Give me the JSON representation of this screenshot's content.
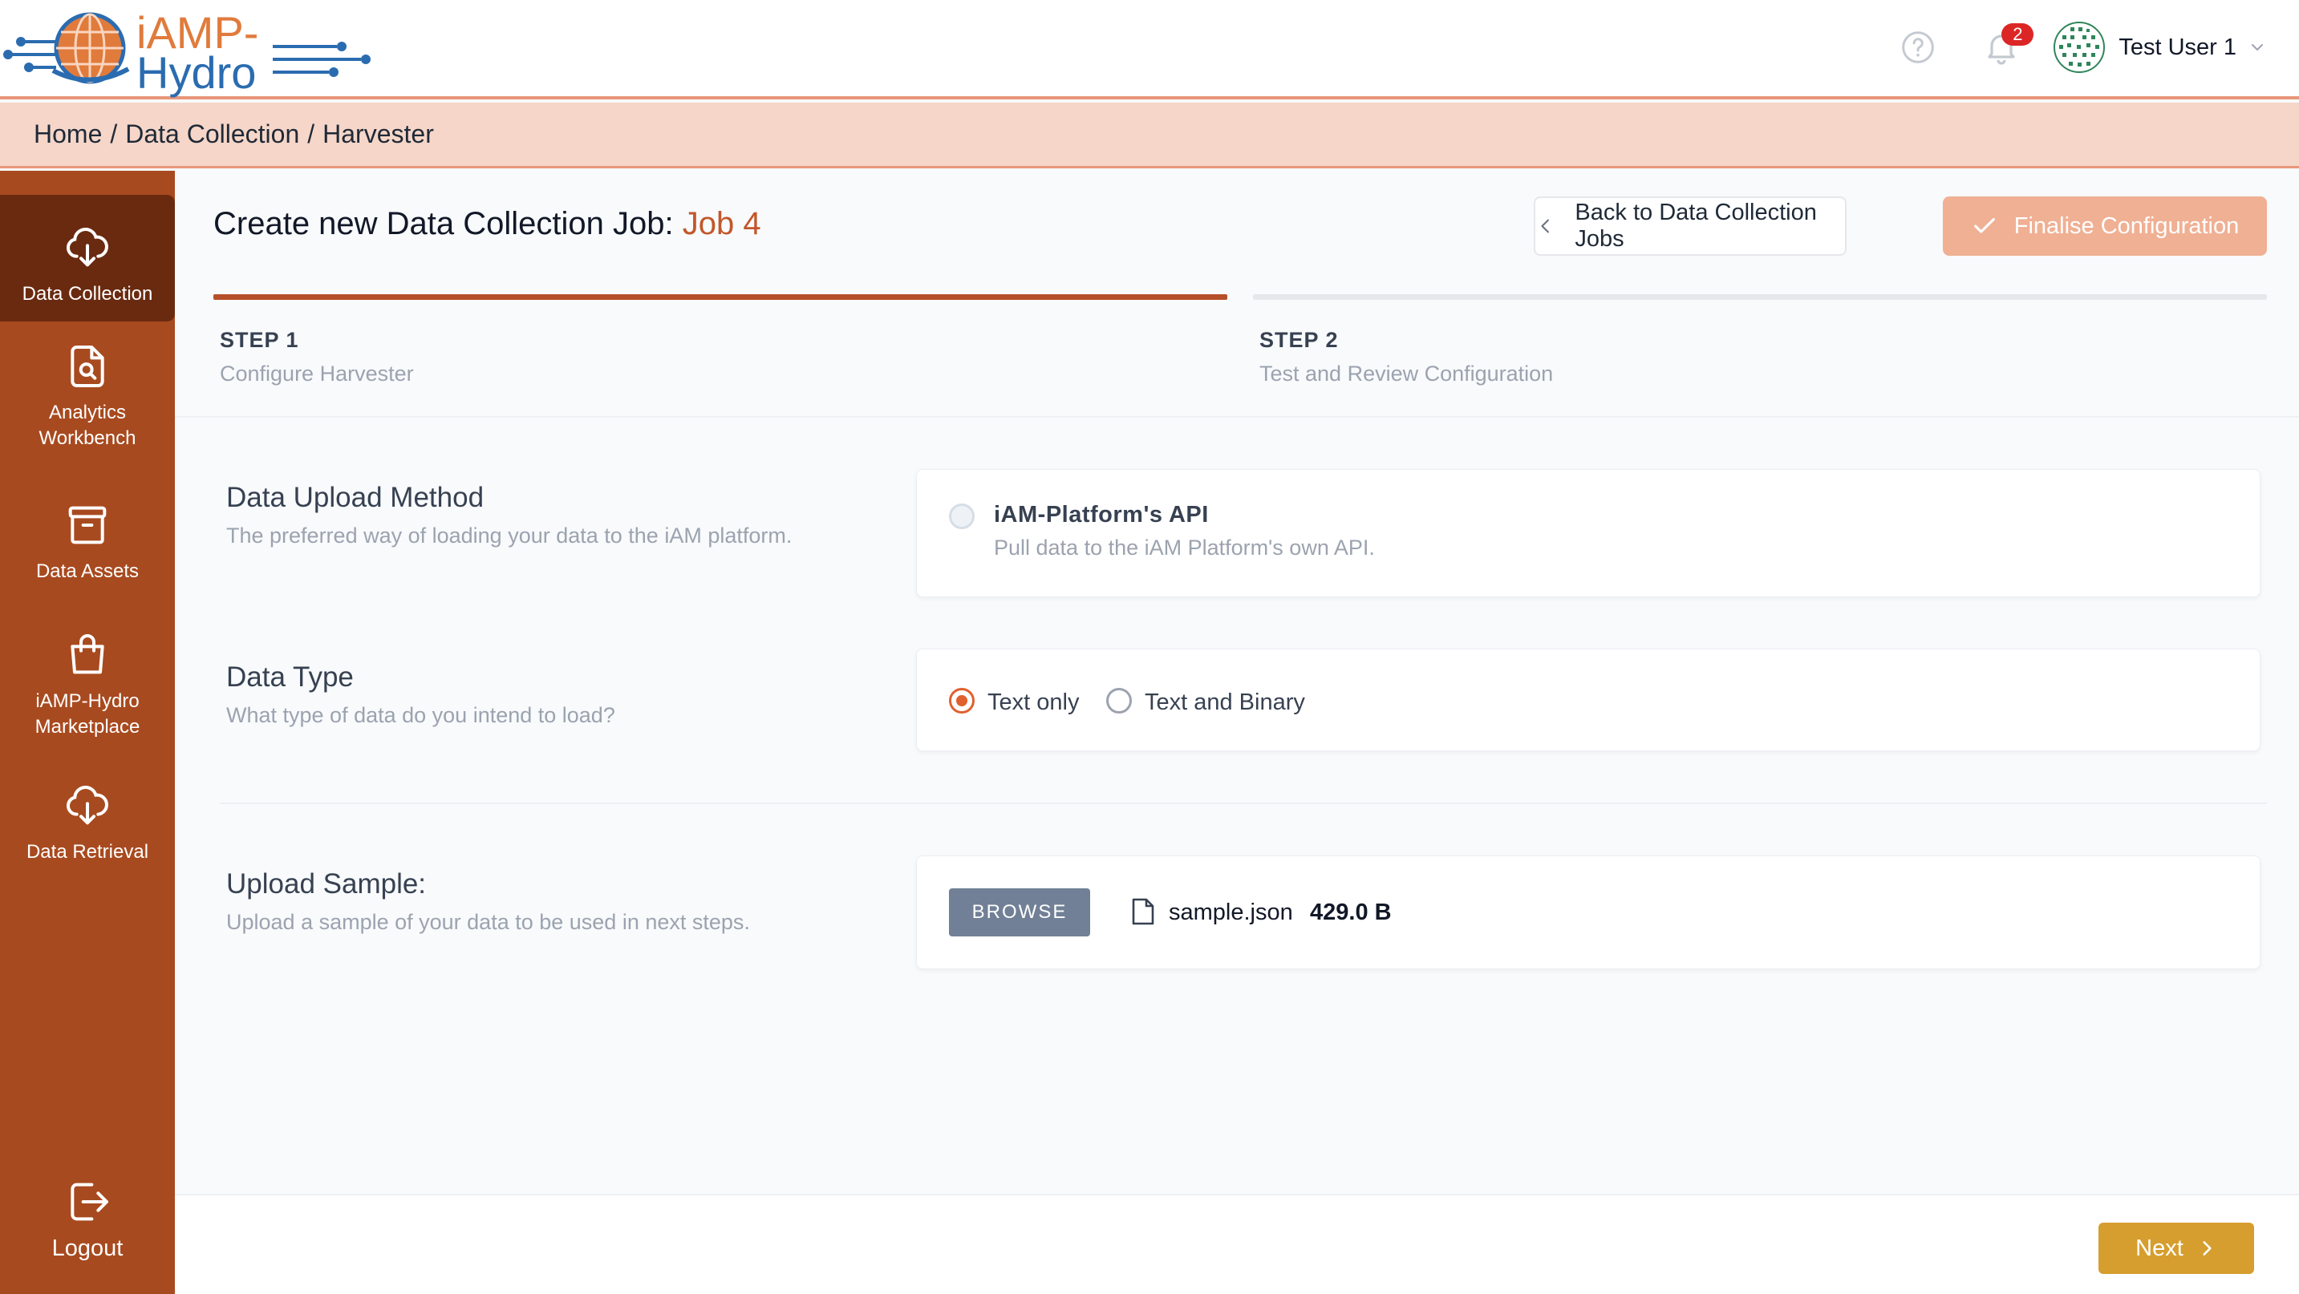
{
  "header": {
    "logo": {
      "line1": "iAMP-",
      "line2": "Hydro"
    },
    "notifications_count": "2",
    "user_name": "Test User 1"
  },
  "breadcrumb": {
    "items": [
      "Home",
      "Data Collection",
      "Harvester"
    ]
  },
  "sidebar": {
    "items": [
      {
        "label": "Data Collection",
        "icon": "cloud-download-icon"
      },
      {
        "label": "Analytics Workbench",
        "icon": "file-search-icon"
      },
      {
        "label": "Data Assets",
        "icon": "archive-box-icon"
      },
      {
        "label": "iAMP-Hydro Marketplace",
        "icon": "shopping-bag-icon"
      },
      {
        "label": "Data Retrieval",
        "icon": "cloud-download-icon"
      }
    ],
    "logout_label": "Logout"
  },
  "main": {
    "title_prefix": "Create new Data Collection Job:",
    "job_name": "Job 4",
    "back_label": "Back to Data Collection Jobs",
    "finalise_label": "Finalise Configuration",
    "steps": [
      {
        "label": "STEP 1",
        "sub": "Configure Harvester"
      },
      {
        "label": "STEP 2",
        "sub": "Test and Review Configuration"
      }
    ],
    "upload_method": {
      "title": "Data Upload Method",
      "desc": "The preferred way of loading your data to the iAM platform.",
      "option_title": "iAM-Platform's API",
      "option_desc": "Pull data to the iAM Platform's own API."
    },
    "data_type": {
      "title": "Data Type",
      "desc": "What type of data do you intend to load?",
      "options": [
        "Text only",
        "Text and Binary"
      ],
      "selected": "Text only"
    },
    "upload_sample": {
      "title": "Upload Sample:",
      "desc": "Upload a sample of your data to be used in next steps.",
      "browse_label": "BROWSE",
      "file_name": "sample.json",
      "file_size": "429.0 B"
    },
    "next_label": "Next"
  },
  "colors": {
    "sidebar": "#a84a1f",
    "sidebar_active": "#6a2a10",
    "breadcrumb_bg": "#f5d6c8",
    "accent": "#c2572a",
    "finalise_button": "#f0b094",
    "next_button": "#d69e2e",
    "browse_button": "#718096"
  }
}
